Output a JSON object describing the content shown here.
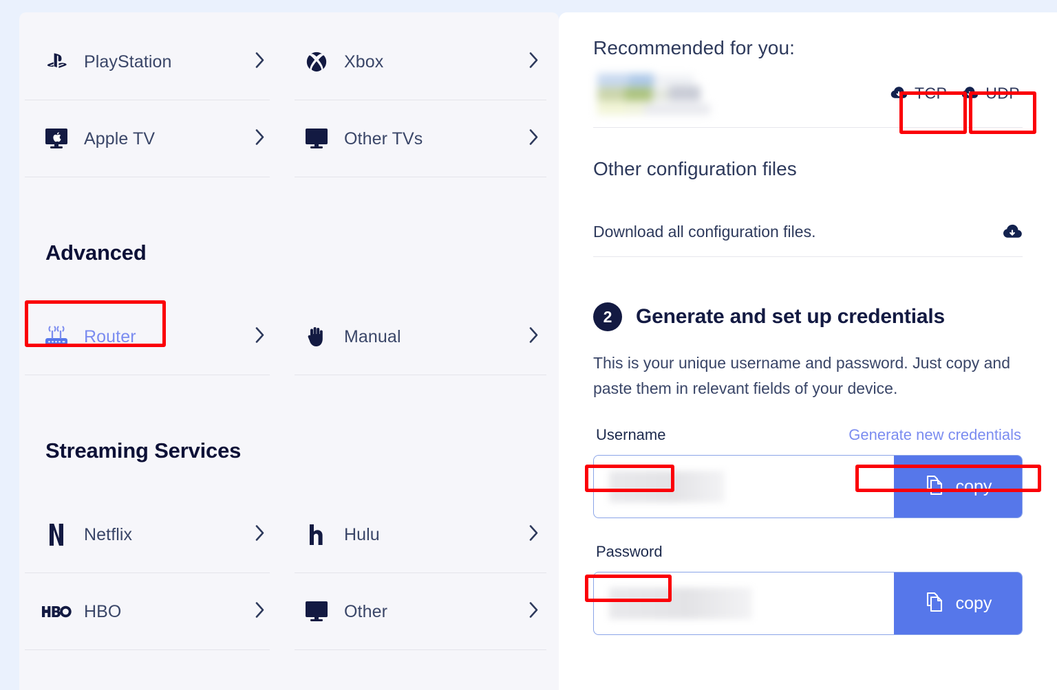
{
  "left_panel": {
    "top_devices": [
      {
        "label": "PlayStation",
        "icon": "playstation-icon",
        "chevron": "chevron-right-icon"
      },
      {
        "label": "Xbox",
        "icon": "xbox-icon",
        "chevron": "chevron-right-icon"
      },
      {
        "label": "Apple TV",
        "icon": "apple-tv-icon",
        "chevron": "chevron-right-icon"
      },
      {
        "label": "Other TVs",
        "icon": "tv-icon",
        "chevron": "chevron-right-icon"
      }
    ],
    "advanced": {
      "heading": "Advanced",
      "items": [
        {
          "label": "Router",
          "icon": "router-icon",
          "selected": true,
          "highlighted": true
        },
        {
          "label": "Manual",
          "icon": "hand-icon",
          "selected": false,
          "highlighted": false
        }
      ]
    },
    "streaming": {
      "heading": "Streaming Services",
      "items": [
        {
          "label": "Netflix",
          "icon": "netflix-icon"
        },
        {
          "label": "Hulu",
          "icon": "hulu-icon"
        },
        {
          "label": "HBO",
          "icon": "hbo-icon"
        },
        {
          "label": "Other",
          "icon": "tv-icon"
        }
      ]
    }
  },
  "right_panel": {
    "recommended_heading": "Recommended for you:",
    "recommended_server_name": "",
    "download_buttons": [
      {
        "label": "TCP",
        "icon": "cloud-download-icon",
        "highlighted": true
      },
      {
        "label": "UDP",
        "icon": "cloud-download-icon",
        "highlighted": true
      }
    ],
    "other_files_heading": "Other configuration files",
    "download_all_text": "Download all configuration files.",
    "download_all_icon": "cloud-download-icon",
    "step": {
      "number": "2",
      "title": "Generate and set up credentials",
      "description": "This is your unique username and password. Just copy and paste them in relevant fields of your device."
    },
    "credentials": {
      "username_label": "Username",
      "username_value": "",
      "password_label": "Password",
      "password_value": "",
      "generate_link": "Generate new credentials",
      "copy_label": "copy",
      "copy_icon": "copy-icon"
    }
  },
  "colors": {
    "page_background": "#eaf1fd",
    "left_card": "#f6f6fa",
    "right_card": "#ffffff",
    "annotation_red": "#fb0007",
    "accent_blue": "#5677ea",
    "link_blue": "#7b8cf0",
    "navy": "#131a42",
    "body_text": "#3a4668"
  }
}
